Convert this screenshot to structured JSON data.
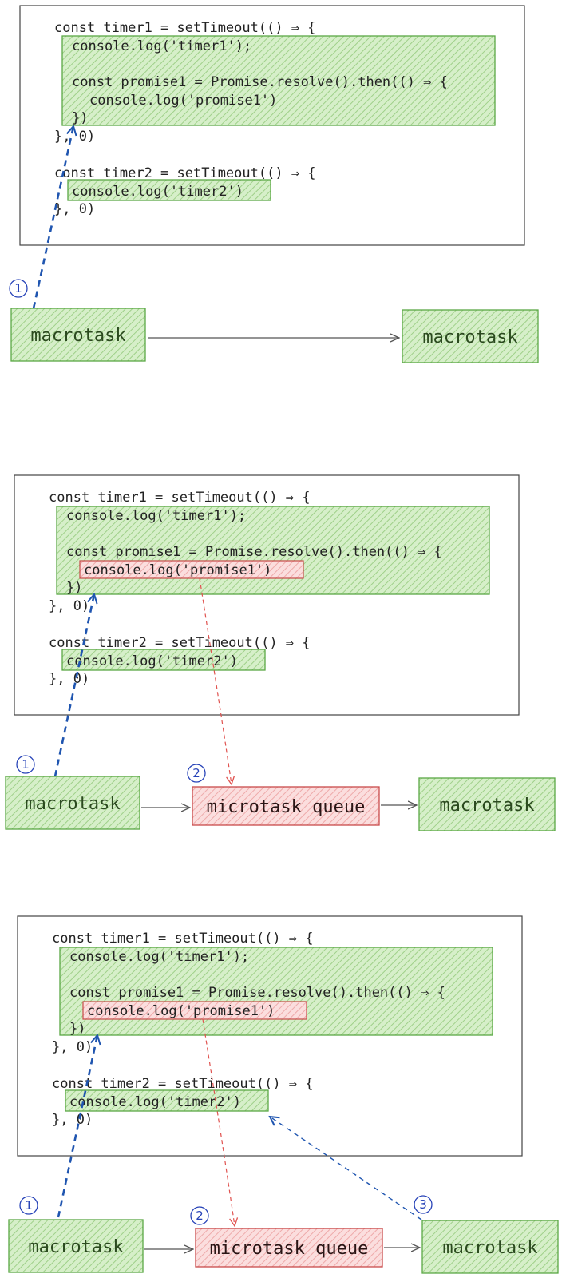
{
  "colors": {
    "green_fill": "#b9e3a9",
    "green_stroke": "#5aa845",
    "red_fill": "#f7c6c6",
    "red_stroke": "#c94a4a",
    "blue_arrow": "#1f55b0",
    "red_arrow": "#e0524f",
    "frame_stroke": "#444444"
  },
  "code": {
    "l1": "const timer1 = setTimeout(() ⇒ {",
    "l2": "console.log('timer1');",
    "l3": "const promise1 = Promise.resolve().then(() ⇒ {",
    "l4": "console.log('promise1')",
    "l5": "})",
    "l6": "}, 0)",
    "l7": "const timer2 = setTimeout(() ⇒ {",
    "l8": "console.log('timer2')",
    "l9": "}, 0)"
  },
  "labels": {
    "macrotask": "macrotask",
    "microtask_queue": "microtask queue"
  },
  "badges": {
    "one": "1",
    "two": "2",
    "three": "3"
  },
  "panels": [
    {
      "name": "panel-1",
      "boxes": [
        "macrotask",
        "macrotask"
      ],
      "badges": [
        "1"
      ]
    },
    {
      "name": "panel-2",
      "boxes": [
        "macrotask",
        "microtask queue",
        "macrotask"
      ],
      "badges": [
        "1",
        "2"
      ]
    },
    {
      "name": "panel-3",
      "boxes": [
        "macrotask",
        "microtask queue",
        "macrotask"
      ],
      "badges": [
        "1",
        "2",
        "3"
      ]
    }
  ]
}
